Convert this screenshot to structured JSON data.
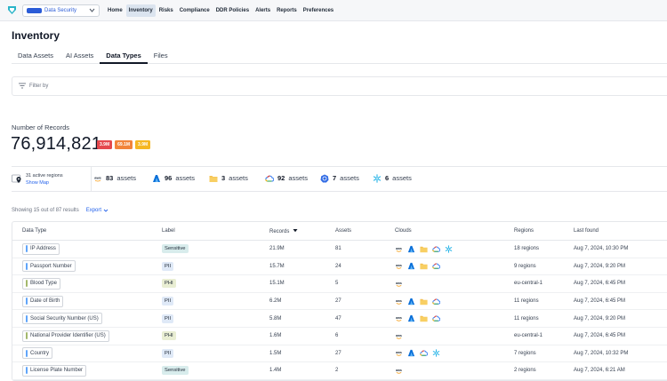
{
  "nav": {
    "org_name": "Data Security",
    "items": [
      {
        "label": "Home",
        "active": false
      },
      {
        "label": "Inventory",
        "active": true
      },
      {
        "label": "Risks",
        "active": false
      },
      {
        "label": "Compliance",
        "active": false
      },
      {
        "label": "DDR Policies",
        "active": false
      },
      {
        "label": "Alerts",
        "active": false
      },
      {
        "label": "Reports",
        "active": false
      },
      {
        "label": "Preferences",
        "active": false
      }
    ]
  },
  "page": {
    "title": "Inventory",
    "tabs": [
      {
        "label": "Data Assets",
        "active": false
      },
      {
        "label": "AI Assets",
        "active": false
      },
      {
        "label": "Data Types",
        "active": true
      },
      {
        "label": "Files",
        "active": false
      }
    ],
    "filter_placeholder": "Filter by"
  },
  "records": {
    "label": "Number of Records",
    "value": "76,914,821",
    "badges": [
      {
        "text": "3.9M",
        "color": "#e5484d"
      },
      {
        "text": "69.1M",
        "color": "#f2843a"
      },
      {
        "text": "3.9M",
        "color": "#f5b722"
      }
    ]
  },
  "stats": {
    "regions": "31 active regions",
    "show_map": "Show Map",
    "clouds": [
      {
        "icon": "aws-icon",
        "count": "83",
        "unit": "assets"
      },
      {
        "icon": "azure-icon",
        "count": "96",
        "unit": "assets"
      },
      {
        "icon": "folder-icon",
        "count": "3",
        "unit": "assets"
      },
      {
        "icon": "gcp-icon",
        "count": "92",
        "unit": "assets"
      },
      {
        "icon": "kubernetes-icon",
        "count": "7",
        "unit": "assets"
      },
      {
        "icon": "snowflake-icon",
        "count": "6",
        "unit": "assets"
      }
    ]
  },
  "results": {
    "showing": "Showing 15 out of 87 results",
    "export": "Export"
  },
  "table": {
    "headers": [
      "Data Type",
      "Label",
      "Records",
      "Assets",
      "Clouds",
      "Regions",
      "Last found"
    ],
    "rows": [
      {
        "type": "IP Address",
        "bar": "#60a5fa",
        "label": "Sensitive",
        "records": "21.9M",
        "assets": "81",
        "clouds": [
          "aws",
          "azure",
          "folder",
          "gcp",
          "snowflake"
        ],
        "regions": "18 regions",
        "last": "Aug 7, 2024, 10:30 PM"
      },
      {
        "type": "Passport Number",
        "bar": "#60a5fa",
        "label": "PII",
        "records": "15.7M",
        "assets": "24",
        "clouds": [
          "aws",
          "azure",
          "folder",
          "gcp"
        ],
        "regions": "9 regions",
        "last": "Aug 7, 2024, 9:20 PM"
      },
      {
        "type": "Blood Type",
        "bar": "#a3b86c",
        "label": "PHI",
        "records": "15.1M",
        "assets": "5",
        "clouds": [
          "aws"
        ],
        "regions": "eu-central-1",
        "last": "Aug 7, 2024, 6:45 PM"
      },
      {
        "type": "Date of Birth",
        "bar": "#60a5fa",
        "label": "PII",
        "records": "6.2M",
        "assets": "27",
        "clouds": [
          "aws",
          "azure",
          "folder",
          "gcp"
        ],
        "regions": "11 regions",
        "last": "Aug 7, 2024, 6:45 PM"
      },
      {
        "type": "Social Security Number (US)",
        "bar": "#60a5fa",
        "label": "PII",
        "records": "5.8M",
        "assets": "47",
        "clouds": [
          "aws",
          "azure",
          "folder",
          "gcp"
        ],
        "regions": "11 regions",
        "last": "Aug 7, 2024, 9:20 PM"
      },
      {
        "type": "National Provider Identifier (US)",
        "bar": "#a3b86c",
        "label": "PHI",
        "records": "1.6M",
        "assets": "6",
        "clouds": [
          "aws"
        ],
        "regions": "eu-central-1",
        "last": "Aug 7, 2024, 6:45 PM"
      },
      {
        "type": "Country",
        "bar": "#60a5fa",
        "label": "PII",
        "records": "1.5M",
        "assets": "27",
        "clouds": [
          "aws",
          "azure",
          "gcp",
          "snowflake"
        ],
        "regions": "7 regions",
        "last": "Aug 7, 2024, 10:32 PM"
      },
      {
        "type": "License Plate Number",
        "bar": "#60a5fa",
        "label": "Sensitive",
        "records": "1.4M",
        "assets": "2",
        "clouds": [
          "aws"
        ],
        "regions": "2 regions",
        "last": "Aug 7, 2024, 6:21 AM"
      }
    ]
  },
  "colors": {
    "accent": "#2563eb",
    "sensitive_bg": "#d8ecec",
    "pii_bg": "#dfe9f7",
    "phi_bg": "#e9eed3"
  }
}
